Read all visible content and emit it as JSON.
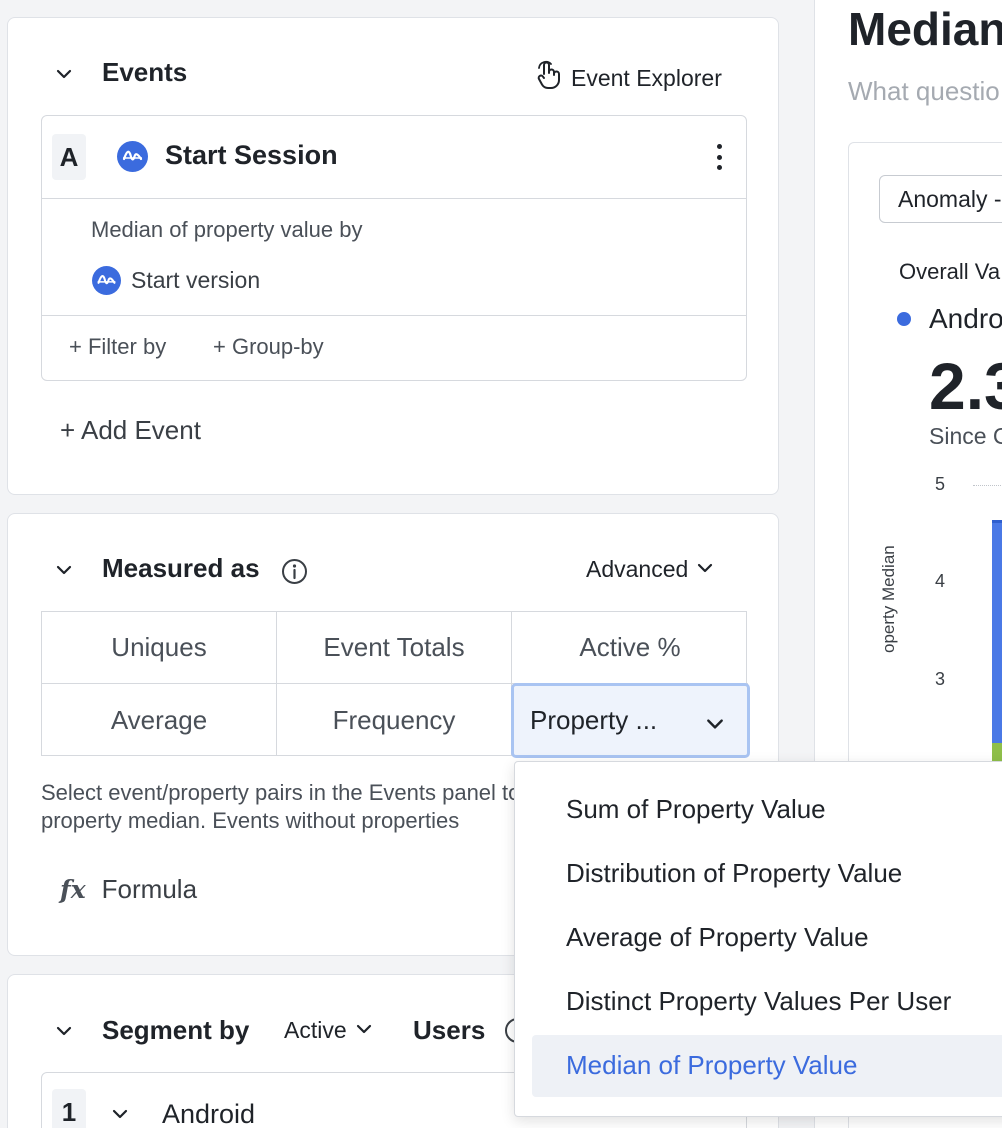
{
  "events_panel": {
    "title": "Events",
    "event_explorer_label": "Event Explorer",
    "event": {
      "letter": "A",
      "name": "Start Session",
      "aggregation_label": "Median of property value by",
      "property": "Start version",
      "filter_label": "+ Filter by",
      "group_label": "+ Group-by"
    },
    "add_event_label": "+ Add Event"
  },
  "measured_panel": {
    "title": "Measured as",
    "mode_label": "Advanced",
    "options": [
      "Uniques",
      "Event Totals",
      "Active %",
      "Average",
      "Frequency"
    ],
    "selected_option": "Property ...",
    "hint_line1": "Select event/property pairs in the Events panel to compute",
    "hint_line2": "property median. Events without properties",
    "formula_icon": "fx",
    "formula_label": "Formula"
  },
  "segment_panel": {
    "title": "Segment by",
    "active_label": "Active",
    "users_label": "Users",
    "segment": {
      "number": "1",
      "name": "Android"
    }
  },
  "property_dropdown": {
    "items": [
      "Sum of Property Value",
      "Distribution of Property Value",
      "Average of Property Value",
      "Distinct Property Values Per User",
      "Median of Property Value"
    ],
    "selected": "Median of Property Value"
  },
  "chart_area": {
    "title": "Median",
    "subtitle": "What questio",
    "anomaly_label": "Anomaly -",
    "overall_label": "Overall Va",
    "legend_series": "Andro",
    "big_value": "2.3",
    "since_label": "Since C",
    "y_axis_label": "operty Median",
    "y_ticks": [
      "5",
      "4",
      "3"
    ]
  },
  "colors": {
    "accent": "#3b6bde",
    "selected_bg": "#eef3fc",
    "selected_border": "#a9c4f2",
    "green_series": "#8fbf4a"
  }
}
